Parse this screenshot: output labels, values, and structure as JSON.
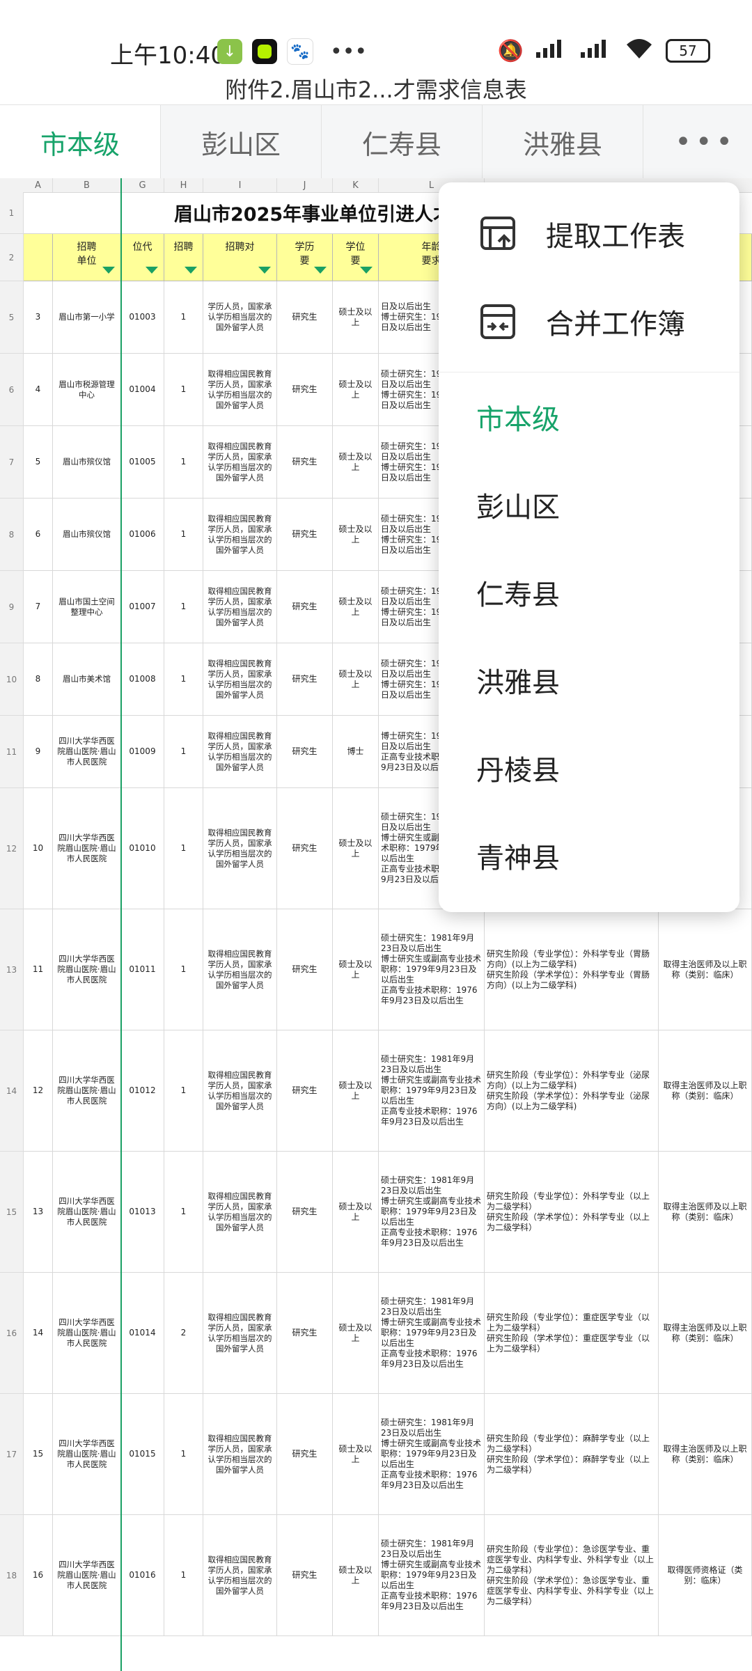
{
  "status_bar": {
    "time": "上午10:40",
    "battery": "57"
  },
  "doc_title": "附件2.眉山市2...才需求信息表",
  "tabs": [
    {
      "label": "市本级",
      "active": true
    },
    {
      "label": "彭山区",
      "active": false
    },
    {
      "label": "仁寿县",
      "active": false
    },
    {
      "label": "洪雅县",
      "active": false
    }
  ],
  "more_label": "•••",
  "sheet": {
    "title": "眉山市2025年事业单位引进人才",
    "columns": [
      "A",
      "B",
      "G",
      "H",
      "I",
      "J",
      "K",
      "L"
    ],
    "headers": [
      "",
      "招聘\n单位",
      "位代",
      "招聘",
      "招聘对",
      "学历\n要",
      "学位\n要",
      "年龄\n要求"
    ],
    "row_numbers": [
      "1",
      "2",
      "5",
      "6",
      "7",
      "8",
      "9",
      "10",
      "11",
      "12",
      "13",
      "14",
      "15",
      "16",
      "17",
      "18"
    ],
    "rows": [
      {
        "a": "3",
        "b": "眉山市第一小学",
        "g": "01003",
        "h": "1",
        "i": "学历人员，国家承认学历相当层次的国外留学人员",
        "j": "研究生",
        "k": "硕士及以上",
        "l": "日及以后出生\n博士研究生：19\n日及以后出生",
        "m": "",
        "n": ""
      },
      {
        "a": "4",
        "b": "眉山市税源管理中心",
        "g": "01004",
        "h": "1",
        "i": "取得相应国民教育学历人员，国家承认学历相当层次的国外留学人员",
        "j": "研究生",
        "k": "硕士及以上",
        "l": "硕士研究生：19\n日及以后出生\n博士研究生：19\n日及以后出生",
        "m": "",
        "n": ""
      },
      {
        "a": "5",
        "b": "眉山市殡仪馆",
        "g": "01005",
        "h": "1",
        "i": "取得相应国民教育学历人员，国家承认学历相当层次的国外留学人员",
        "j": "研究生",
        "k": "硕士及以上",
        "l": "硕士研究生：19\n日及以后出生\n博士研究生：19\n日及以后出生",
        "m": "",
        "n": ""
      },
      {
        "a": "6",
        "b": "眉山市殡仪馆",
        "g": "01006",
        "h": "1",
        "i": "取得相应国民教育学历人员，国家承认学历相当层次的国外留学人员",
        "j": "研究生",
        "k": "硕士及以上",
        "l": "硕士研究生：19\n日及以后出生\n博士研究生：19\n日及以后出生",
        "m": "",
        "n": ""
      },
      {
        "a": "7",
        "b": "眉山市国土空间整理中心",
        "g": "01007",
        "h": "1",
        "i": "取得相应国民教育学历人员，国家承认学历相当层次的国外留学人员",
        "j": "研究生",
        "k": "硕士及以上",
        "l": "硕士研究生：19\n日及以后出生\n博士研究生：19\n日及以后出生",
        "m": "",
        "n": ""
      },
      {
        "a": "8",
        "b": "眉山市美术馆",
        "g": "01008",
        "h": "1",
        "i": "取得相应国民教育学历人员，国家承认学历相当层次的国外留学人员",
        "j": "研究生",
        "k": "硕士及以上",
        "l": "硕士研究生：19\n日及以后出生\n博士研究生：19\n日及以后出生",
        "m": "",
        "n": ""
      },
      {
        "a": "9",
        "b": "四川大学华西医院眉山医院·眉山市人民医院",
        "g": "01009",
        "h": "1",
        "i": "取得相应国民教育学历人员，国家承认学历相当层次的国外留学人员",
        "j": "研究生",
        "k": "博士",
        "l": "博士研究生：19\n日及以后出生\n正高专业技术职\n9月23日及以后",
        "m": "",
        "n": ""
      },
      {
        "a": "10",
        "b": "四川大学华西医院眉山医院·眉山市人民医院",
        "g": "01010",
        "h": "1",
        "i": "取得相应国民教育学历人员，国家承认学历相当层次的国外留学人员",
        "j": "研究生",
        "k": "硕士及以上",
        "l": "硕士研究生：19\n日及以后出生\n博士研究生或副\n术职称：1979年\n以后出生\n正高专业技术职\n9月23日及以后",
        "m": "",
        "n": ""
      },
      {
        "a": "11",
        "b": "四川大学华西医院眉山医院·眉山市人民医院",
        "g": "01011",
        "h": "1",
        "i": "取得相应国民教育学历人员，国家承认学历相当层次的国外留学人员",
        "j": "研究生",
        "k": "硕士及以上",
        "l": "硕士研究生：1981年9月23日及以后出生\n博士研究生或副高专业技术职称：1979年9月23日及以后出生\n正高专业技术职称：1976年9月23日及以后出生",
        "m": "研究生阶段（专业学位）：外科学专业（胃肠方向）(以上为二级学科)\n研究生阶段（学术学位）：外科学专业（胃肠方向）(以上为二级学科)",
        "n": "取得主治医师及以上职称（类别：临床）"
      },
      {
        "a": "12",
        "b": "四川大学华西医院眉山医院·眉山市人民医院",
        "g": "01012",
        "h": "1",
        "i": "取得相应国民教育学历人员，国家承认学历相当层次的国外留学人员",
        "j": "研究生",
        "k": "硕士及以上",
        "l": "硕士研究生：1981年9月23日及以后出生\n博士研究生或副高专业技术职称：1979年9月23日及以后出生\n正高专业技术职称：1976年9月23日及以后出生",
        "m": "研究生阶段（专业学位）：外科学专业（泌尿方向）(以上为二级学科)\n研究生阶段（学术学位）：外科学专业（泌尿方向）(以上为二级学科)",
        "n": "取得主治医师及以上职称（类别：临床）"
      },
      {
        "a": "13",
        "b": "四川大学华西医院眉山医院·眉山市人民医院",
        "g": "01013",
        "h": "1",
        "i": "取得相应国民教育学历人员，国家承认学历相当层次的国外留学人员",
        "j": "研究生",
        "k": "硕士及以上",
        "l": "硕士研究生：1981年9月23日及以后出生\n博士研究生或副高专业技术职称：1979年9月23日及以后出生\n正高专业技术职称：1976年9月23日及以后出生",
        "m": "研究生阶段（专业学位）：外科学专业（以上为二级学科）\n研究生阶段（学术学位）：外科学专业（以上为二级学科）",
        "n": "取得主治医师及以上职称（类别：临床）"
      },
      {
        "a": "14",
        "b": "四川大学华西医院眉山医院·眉山市人民医院",
        "g": "01014",
        "h": "2",
        "i": "取得相应国民教育学历人员，国家承认学历相当层次的国外留学人员",
        "j": "研究生",
        "k": "硕士及以上",
        "l": "硕士研究生：1981年9月23日及以后出生\n博士研究生或副高专业技术职称：1979年9月23日及以后出生\n正高专业技术职称：1976年9月23日及以后出生",
        "m": "研究生阶段（专业学位）：重症医学专业（以上为二级学科）\n研究生阶段（学术学位）：重症医学专业（以上为二级学科）",
        "n": "取得主治医师及以上职称（类别：临床）"
      },
      {
        "a": "15",
        "b": "四川大学华西医院眉山医院·眉山市人民医院",
        "g": "01015",
        "h": "1",
        "i": "取得相应国民教育学历人员，国家承认学历相当层次的国外留学人员",
        "j": "研究生",
        "k": "硕士及以上",
        "l": "硕士研究生：1981年9月23日及以后出生\n博士研究生或副高专业技术职称：1979年9月23日及以后出生\n正高专业技术职称：1976年9月23日及以后出生",
        "m": "研究生阶段（专业学位）：麻醉学专业（以上为二级学科）\n研究生阶段（学术学位）：麻醉学专业（以上为二级学科）",
        "n": "取得主治医师及以上职称（类别：临床）"
      },
      {
        "a": "16",
        "b": "四川大学华西医院眉山医院·眉山市人民医院",
        "g": "01016",
        "h": "1",
        "i": "取得相应国民教育学历人员，国家承认学历相当层次的国外留学人员",
        "j": "研究生",
        "k": "硕士及以上",
        "l": "硕士研究生：1981年9月23日及以后出生\n博士研究生或副高专业技术职称：1979年9月23日及以后出生\n正高专业技术职称：1976年9月23日及以后出生",
        "m": "研究生阶段（专业学位）：急诊医学专业、重症医学专业、内科学专业、外科学专业（以上为二级学科）\n研究生阶段（学术学位）：急诊医学专业、重症医学专业、内科学专业、外科学专业（以上为二级学科）",
        "n": "取得医师资格证（类别：临床）"
      }
    ]
  },
  "menu": {
    "actions": [
      {
        "label": "提取工作表",
        "icon": "extract-sheet-icon"
      },
      {
        "label": "合并工作簿",
        "icon": "merge-workbook-icon"
      }
    ],
    "sheets": [
      {
        "label": "市本级",
        "active": true
      },
      {
        "label": "彭山区",
        "active": false
      },
      {
        "label": "仁寿县",
        "active": false
      },
      {
        "label": "洪雅县",
        "active": false
      },
      {
        "label": "丹棱县",
        "active": false
      },
      {
        "label": "青神县",
        "active": false
      }
    ]
  },
  "colors": {
    "accent": "#17a36a",
    "header_fill": "#ffff99"
  }
}
